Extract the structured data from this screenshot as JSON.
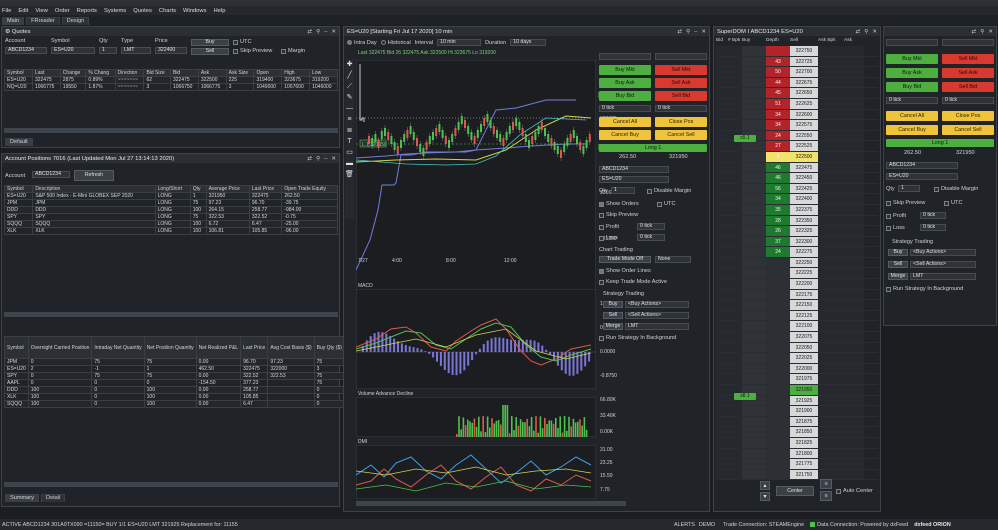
{
  "menu": [
    "File",
    "Edit",
    "View",
    "Order",
    "Reports",
    "Systems",
    "Quotes",
    "Charts",
    "Windows",
    "Help"
  ],
  "workspaces": [
    "Main",
    "FRreader",
    "Design"
  ],
  "quotes": {
    "title": "Quotes",
    "labels": {
      "account": "Account",
      "symbol": "Symbol",
      "qty": "Qty",
      "type": "Type",
      "price": "Price"
    },
    "account": "ABCD1234",
    "symbol": "ES=U20",
    "qty": "1",
    "type": "LMT",
    "price": "322400",
    "buy": "Buy",
    "sell": "Sell",
    "utc": "UTC",
    "skip_preview": "Skip Preview",
    "margin": "Margin",
    "columns": [
      "Symbol",
      "Last",
      "Change",
      "% Chang",
      "Direction",
      "Bid Size",
      "Bid",
      "Ask",
      "Ask Size",
      "Open",
      "High",
      "Low"
    ],
    "rows": [
      [
        "ES=U20",
        "322475",
        "2875",
        "0.89%",
        "~~~~~~~",
        "62",
        "322475",
        "322500",
        "225",
        "319400",
        "323675",
        "319200"
      ],
      [
        "NQ=U20",
        "1066775",
        "19550",
        "1.87%",
        "~~~~~~~",
        "3",
        "1066750",
        "1066775",
        "3",
        "1049000",
        "1067600",
        "1046000"
      ]
    ],
    "tab": "Default"
  },
  "positions": {
    "title": "Account Positions 7016 (Last Updated Mon Jul 27 13:14:13 2020)",
    "account_label": "Account",
    "account": "ABCD1234",
    "refresh": "Refresh",
    "columns": [
      "Symbol",
      "Description",
      "Long/Short",
      "Qty",
      "Average Price",
      "Last Price",
      "Open Trade Equity"
    ],
    "rows": [
      [
        "ES=U20",
        "S&P 500 Index - E-Mini GLOBEX SEP 2020",
        "LONG",
        "1",
        "321950",
        "322475",
        "262.50"
      ],
      [
        "JPM",
        "JPM",
        "LONG",
        "75",
        "97.23",
        "96.70",
        "-39.75"
      ],
      [
        "DDD",
        "DDD",
        "LONG",
        "100",
        "264.15",
        "258.77",
        "-984.00"
      ],
      [
        "SPY",
        "SPY",
        "LONG",
        "75",
        "322.53",
        "322.52",
        "-0.75"
      ],
      [
        "SQQQ",
        "SQQQ",
        "LONG",
        "100",
        "6.72",
        "6.47",
        "-25.00"
      ],
      [
        "XLK",
        "XLK",
        "LONG",
        "100",
        "106.81",
        "105.85",
        "-96.00"
      ]
    ],
    "columns2": [
      "Symbol",
      "Overnight Carried Position",
      "Intraday Net Quantity",
      "Net Position Quantity",
      "Net Realized P&L",
      "Last Price",
      "Avg Cost Basis ($)",
      "Buy Qty ($)",
      "Avg Buy Price ($)",
      "Sell Qty ($)",
      "Avg Sell Price ($)"
    ],
    "rows2": [
      [
        "JPM",
        "0",
        "75",
        "75",
        "0.00",
        "96.70",
        "97.23",
        "75",
        "97.23",
        "0",
        ""
      ],
      [
        "ES=U20",
        "2",
        "-1",
        "1",
        "462.50",
        "322475",
        "322000",
        "3",
        "322025",
        "4",
        "322375"
      ],
      [
        "SPY",
        "0",
        "75",
        "75",
        "0.00",
        "322.52",
        "322.53",
        "75",
        "322.53",
        "0",
        ""
      ],
      [
        "AAPL",
        "0",
        "0",
        "0",
        "-154.50",
        "377.23",
        "",
        "75",
        "377.40",
        "75",
        "375.42"
      ],
      [
        "DDD",
        "100",
        "0",
        "100",
        "0.00",
        "258.77",
        "",
        "0",
        "",
        "0",
        ""
      ],
      [
        "XLK",
        "100",
        "0",
        "100",
        "0.00",
        "105.85",
        "",
        "0",
        "",
        "0",
        ""
      ],
      [
        "SQQQ",
        "100",
        "0",
        "100",
        "0.00",
        "6.47",
        "",
        "0",
        "",
        "0",
        ""
      ]
    ],
    "tabs": [
      "Summary",
      "Detail"
    ]
  },
  "chart": {
    "title": "ES=U20 [Starting Fri Jul 17 2020] 10 min",
    "intraday": "Intra Day",
    "historical": "Historical",
    "interval_label": "Interval",
    "interval": "10 min",
    "duration_label": "Duration",
    "duration": "10 days",
    "infobar": "Last 322475  Bid 26  322475  Ask 322500  Hi 323675  Lo 319200",
    "price_ticks": [
      "322875",
      "322475",
      "322325",
      "321950",
      "321600",
      "321350"
    ],
    "time_ticks": [
      "7/27",
      "4:00",
      "8:00",
      "12:00"
    ],
    "macd_label": "MACD",
    "macd_ticks": [
      "1.75",
      "0.8750",
      "0.0000",
      "-0.8750"
    ],
    "vol_label": "Volume Advance Decline",
    "vol_ticks": [
      "66.80K",
      "33.40K",
      "0.00K"
    ],
    "dmi_label": "DMI",
    "dmi_ticks": [
      "31.00",
      "23.25",
      "15.50",
      "7.75"
    ]
  },
  "trade": {
    "buy_mkt": "Buy Mkt",
    "sell_mkt": "Sell Mkt",
    "buy_ask": "Buy Ask",
    "sell_ask": "Sell Ask",
    "buy_bid": "Buy Bid",
    "sell_bid": "Sell Bid",
    "cancel_all": "Cancel All",
    "close_pos": "Close Pos",
    "cancel_buy": "Cancel Buy",
    "cancel_sell": "Cancel Sell",
    "long": "Long 1",
    "pnl1": "262.50",
    "pnl2": "321950",
    "account": "ABCD1234",
    "symbol": "ES=U20",
    "qty_label": "Qty",
    "qty": "1",
    "disable_margin": "Disable Margin",
    "show_orders": "Show Orders",
    "utc": "UTC",
    "skip_preview": "Skip Preview",
    "profit": "Profit",
    "loss": "Loss",
    "ticks": "0 tick",
    "chart_trading": "Chart Trading",
    "trade_mode": "Trade Mode Off",
    "none": "None",
    "show_order_lines": "Show Order Lines",
    "keep_trade_mode": "Keep Trade Mode Active",
    "strategy_trading": "Strategy Trading",
    "buy_lbl": "Buy",
    "sell_lbl": "Sell",
    "merge": "Merge",
    "buy_actions": "<Buy Actions>",
    "sell_actions": "<Sell Actions>",
    "lmt": "LMT",
    "run_bg": "Run Strategy In Background"
  },
  "dom": {
    "title": "SuperDOM I  ABCD1234  ES=U20",
    "columns": [
      "Bid",
      "# Bpk",
      "Buy",
      "Depth",
      "Sell",
      "Ask Bpk",
      "Ask"
    ],
    "rows": [
      {
        "p": "322750",
        "d": "",
        "t": "ask"
      },
      {
        "p": "322725",
        "d": "43",
        "t": "ask"
      },
      {
        "p": "322700",
        "d": "50",
        "t": "ask"
      },
      {
        "p": "322675",
        "d": "44",
        "t": "ask"
      },
      {
        "p": "322650",
        "d": "45",
        "t": "ask"
      },
      {
        "p": "322625",
        "d": "51",
        "t": "ask"
      },
      {
        "p": "322600",
        "d": "34",
        "t": "ask"
      },
      {
        "p": "322575",
        "d": "34",
        "t": "ask"
      },
      {
        "p": "322550",
        "d": "24",
        "t": "ask"
      },
      {
        "p": "322525",
        "d": "27",
        "t": "ask"
      },
      {
        "p": "322500",
        "d": "4",
        "t": "cur"
      },
      {
        "p": "322475",
        "d": "46",
        "t": "bid"
      },
      {
        "p": "322450",
        "d": "46",
        "t": "bid"
      },
      {
        "p": "322425",
        "d": "56",
        "t": "bid"
      },
      {
        "p": "322400",
        "d": "34",
        "t": "bid"
      },
      {
        "p": "322375",
        "d": "35",
        "t": "bid"
      },
      {
        "p": "322350",
        "d": "28",
        "t": "bid"
      },
      {
        "p": "322325",
        "d": "26",
        "t": "bid"
      },
      {
        "p": "322300",
        "d": "37",
        "t": "bid"
      },
      {
        "p": "322275",
        "d": "24",
        "t": "bid"
      },
      {
        "p": "322250",
        "d": "",
        "t": "n"
      },
      {
        "p": "322225",
        "d": "",
        "t": "n"
      },
      {
        "p": "322200",
        "d": "",
        "t": "n"
      },
      {
        "p": "322175",
        "d": "",
        "t": "n"
      },
      {
        "p": "322150",
        "d": "",
        "t": "n"
      },
      {
        "p": "322125",
        "d": "",
        "t": "n"
      },
      {
        "p": "322100",
        "d": "",
        "t": "n"
      },
      {
        "p": "322075",
        "d": "",
        "t": "n"
      },
      {
        "p": "322050",
        "d": "",
        "t": "n"
      },
      {
        "p": "322025",
        "d": "",
        "t": "n"
      },
      {
        "p": "322000",
        "d": "",
        "t": "n"
      },
      {
        "p": "321975",
        "d": "",
        "t": "n"
      },
      {
        "p": "321950",
        "d": "",
        "t": "g"
      },
      {
        "p": "321925",
        "d": "",
        "t": "n"
      },
      {
        "p": "321900",
        "d": "",
        "t": "n"
      },
      {
        "p": "321875",
        "d": "",
        "t": "n"
      },
      {
        "p": "321850",
        "d": "",
        "t": "n"
      },
      {
        "p": "321825",
        "d": "",
        "t": "n"
      },
      {
        "p": "321800",
        "d": "",
        "t": "n"
      },
      {
        "p": "321775",
        "d": "",
        "t": "n"
      },
      {
        "p": "321750",
        "d": "",
        "t": "n"
      }
    ],
    "order1": "x5 1",
    "order2": "x8 1",
    "center": "Center",
    "auto_center": "Auto Center"
  },
  "rtrade": {
    "buy_mkt": "Buy Mkt",
    "sell_mkt": "Sell Mkt",
    "buy_ask": "Buy Ask",
    "sell_ask": "Sell Ask",
    "buy_bid": "Buy Bid",
    "sell_bid": "Sell Bid",
    "cancel_all": "Cancel All",
    "close_pos": "Close Pos",
    "cancel_buy": "Cancel Buy",
    "cancel_sell": "Cancel Sell",
    "long": "Long 1",
    "pnl1": "262.50",
    "pnl2": "321950",
    "tick": "0 tick"
  },
  "status": {
    "left": "ACTIVE ABCD1234 301A9TX090 =11150= BUY 1/1 ES=U20 LMT 321925  Replacement for: 11155",
    "alerts": "ALERTS",
    "demo": "DEMO",
    "trade_conn": "Trade Connection: STEAMEngine",
    "data_conn": "Data Connection: Powered by dxFeed",
    "brand": "dxfeed ORION"
  },
  "colors": {
    "buy": "#4caf3f",
    "sell": "#d93a2f",
    "cancel": "#f0c43a",
    "ask_dom": "#b3242a",
    "bid_dom": "#1e7a2e"
  }
}
